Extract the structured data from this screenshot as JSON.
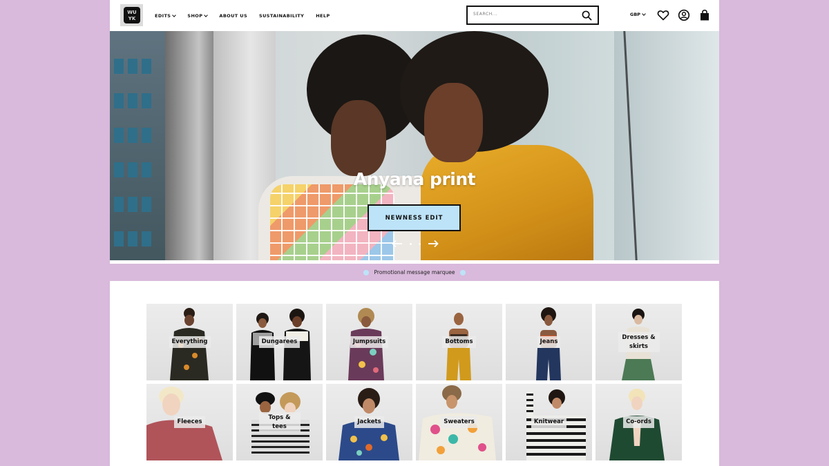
{
  "header": {
    "logo_icon": "wuyk-logo-icon",
    "nav": [
      {
        "label": "EDITS",
        "dropdown": true
      },
      {
        "label": "SHOP",
        "dropdown": true
      },
      {
        "label": "ABOUT US",
        "dropdown": false
      },
      {
        "label": "SUSTAINABILITY",
        "dropdown": false
      },
      {
        "label": "HELP",
        "dropdown": false
      }
    ],
    "search_placeholder": "SEARCH...",
    "currency": "GBP",
    "icons": [
      "search-icon",
      "heart-icon",
      "account-icon",
      "bag-icon"
    ]
  },
  "hero": {
    "title": "Anyana print",
    "button_label": "NEWNESS EDIT",
    "button_color": "#bde3f8",
    "slides_count": 3,
    "active_slide": 1
  },
  "marquee": {
    "text": "Promotional message marquee"
  },
  "categories": [
    {
      "label": "Everything"
    },
    {
      "label": "Dungarees"
    },
    {
      "label": "Jumpsuits"
    },
    {
      "label": "Bottoms"
    },
    {
      "label": "Jeans"
    },
    {
      "label": "Dresses & skirts"
    },
    {
      "label": "Fleeces"
    },
    {
      "label": "Tops & tees"
    },
    {
      "label": "Jackets"
    },
    {
      "label": "Sweaters"
    },
    {
      "label": "Knitwear"
    },
    {
      "label": "Co-ords"
    }
  ],
  "colors": {
    "page_background": "#d9b9dc",
    "accent": "#bde3f8",
    "text": "#111111"
  }
}
